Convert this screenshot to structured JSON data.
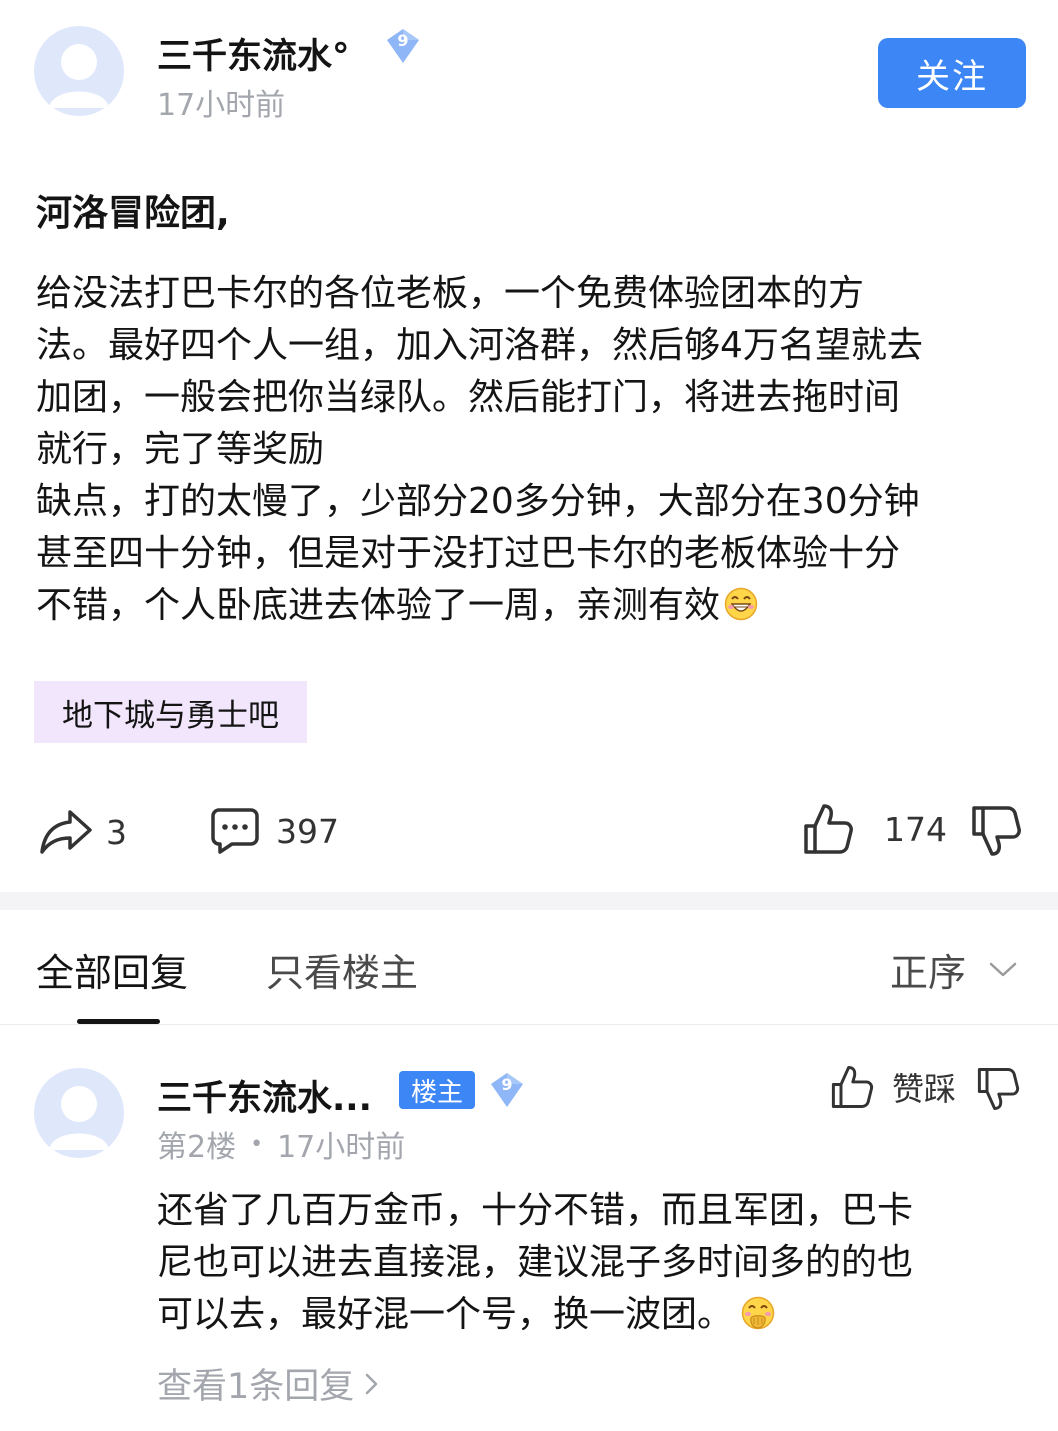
{
  "post": {
    "author": "三千东流水°",
    "level": "9",
    "time": "17小时前",
    "follow_label": "关注",
    "title": "河洛冒险团,",
    "body_lines": [
      "给没法打巴卡尔的各位老板，一个免费体验团本的方",
      "法。最好四个人一组，加入河洛群，然后够4万名望就去",
      "加团，一般会把你当绿队。然后能打门，将进去拖时间",
      "就行，完了等奖励",
      "缺点，打的太慢了，少部分20多分钟，大部分在30分钟",
      "甚至四十分钟，但是对于没打过巴卡尔的老板体验十分",
      "不错，个人卧底进去体验了一周，亲测有效"
    ],
    "tag": "地下城与勇士吧",
    "share_count": "3",
    "comment_count": "397",
    "like_count": "174"
  },
  "tabs": {
    "all_replies": "全部回复",
    "only_op": "只看楼主",
    "sort": "正序"
  },
  "reply": {
    "author": "三千东流水...",
    "op_badge": "楼主",
    "level": "9",
    "floor": "第2楼",
    "separator": "•",
    "time": "17小时前",
    "like_label": "赞踩",
    "body_lines": [
      "还省了几百万金币，十分不错，而且军团，巴卡",
      "尼也可以进去直接混，建议混子多时间多的的也",
      "可以去，最好混一个号，换一波团。"
    ],
    "view_replies": "查看1条回复"
  },
  "colors": {
    "accent": "#3d86f5",
    "tag_bg": "#f1e6fb",
    "muted": "#a3a6ad"
  },
  "icons": [
    "share-icon",
    "comment-icon",
    "thumbs-up-icon",
    "thumbs-down-icon",
    "chevron-down-icon",
    "chevron-right-icon",
    "grin-emoji-icon",
    "giggle-emoji-icon"
  ]
}
